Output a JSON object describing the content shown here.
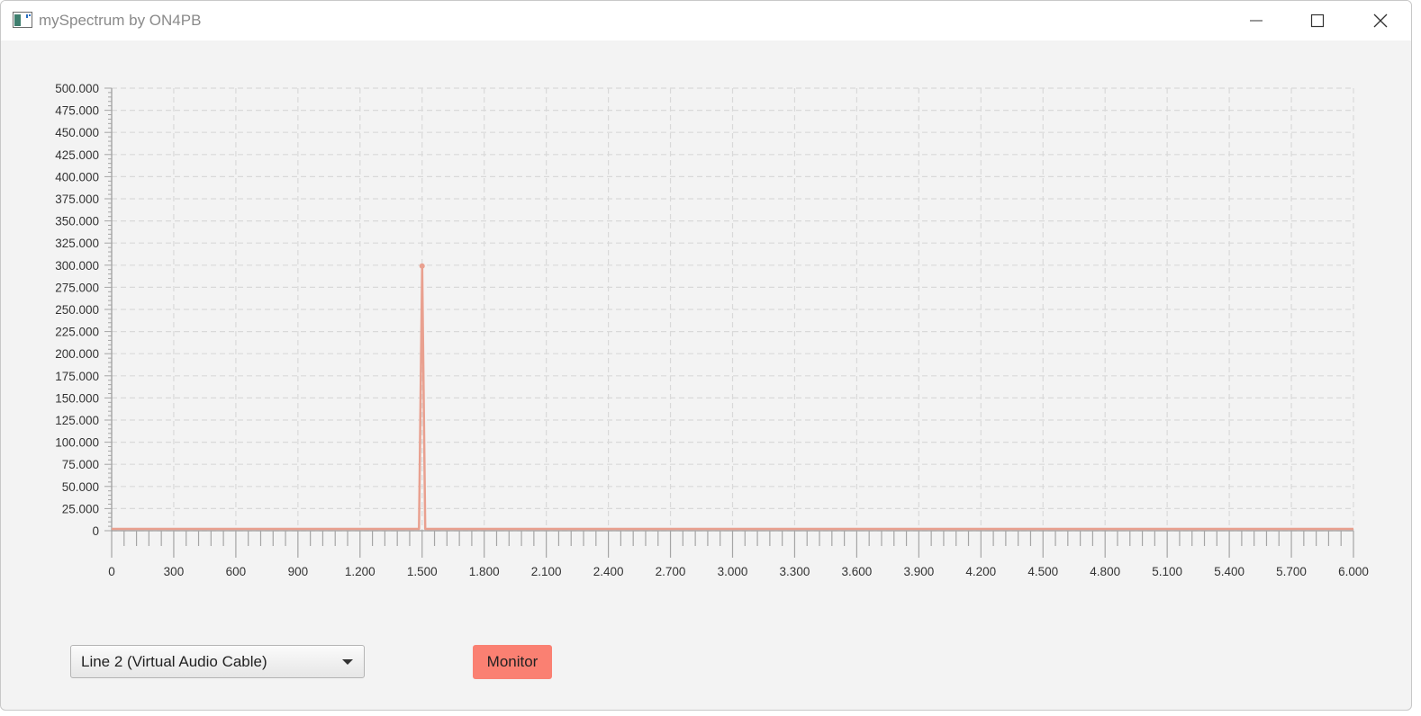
{
  "window": {
    "title": "mySpectrum by ON4PB",
    "icons": [
      "app-icon",
      "minimize-icon",
      "maximize-icon",
      "close-icon"
    ]
  },
  "controls": {
    "device_select_value": "Line 2 (Virtual Audio Cable)",
    "monitor_label": "Monitor",
    "monitor_color": "#fa8072"
  },
  "chart_data": {
    "type": "line",
    "title": "",
    "xlabel": "",
    "ylabel": "",
    "xlim": [
      0,
      6000
    ],
    "ylim": [
      0,
      500000
    ],
    "grid": true,
    "legend": "none",
    "series_color": "#e9a08f",
    "x_tick_labels": [
      "0",
      "300",
      "600",
      "900",
      "1.200",
      "1.500",
      "1.800",
      "2.100",
      "2.400",
      "2.700",
      "3.000",
      "3.300",
      "3.600",
      "3.900",
      "4.200",
      "4.500",
      "4.800",
      "5.100",
      "5.400",
      "5.700",
      "6.000"
    ],
    "y_tick_labels": [
      "0",
      "25.000",
      "50.000",
      "75.000",
      "100.000",
      "125.000",
      "150.000",
      "175.000",
      "200.000",
      "225.000",
      "250.000",
      "275.000",
      "300.000",
      "325.000",
      "350.000",
      "375.000",
      "400.000",
      "425.000",
      "450.000",
      "475.000",
      "500.000"
    ],
    "series": [
      {
        "x": [
          0,
          1470,
          1485,
          1500,
          1515,
          1530,
          6000
        ],
        "values": [
          2000,
          2000,
          2000,
          299000,
          2000,
          2000,
          2000
        ]
      }
    ]
  }
}
